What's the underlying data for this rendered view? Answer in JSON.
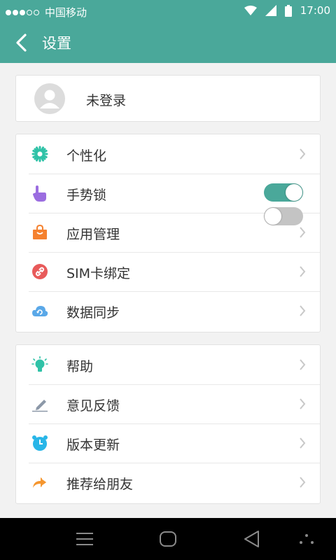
{
  "status": {
    "carrier": "中国移动",
    "time": "17:00"
  },
  "header": {
    "title": "设置"
  },
  "profile": {
    "name": "未登录"
  },
  "group1": [
    {
      "label": "个性化",
      "icon": "sparkle-icon"
    },
    {
      "label": "手势锁",
      "icon": "hand-pointer-icon",
      "toggle_on": true
    },
    {
      "label": "应用管理",
      "icon": "shopping-bag-icon"
    },
    {
      "label": "SIM卡绑定",
      "icon": "link-icon"
    },
    {
      "label": "数据同步",
      "icon": "cloud-sync-icon"
    }
  ],
  "group2": [
    {
      "label": "帮助",
      "icon": "lightbulb-icon"
    },
    {
      "label": "意见反馈",
      "icon": "pencil-icon"
    },
    {
      "label": "版本更新",
      "icon": "alarm-clock-icon"
    },
    {
      "label": "推荐给朋友",
      "icon": "share-forward-icon"
    }
  ],
  "colors": {
    "primary": "#4aa89a",
    "toggle_off": "#c4c4c4"
  }
}
